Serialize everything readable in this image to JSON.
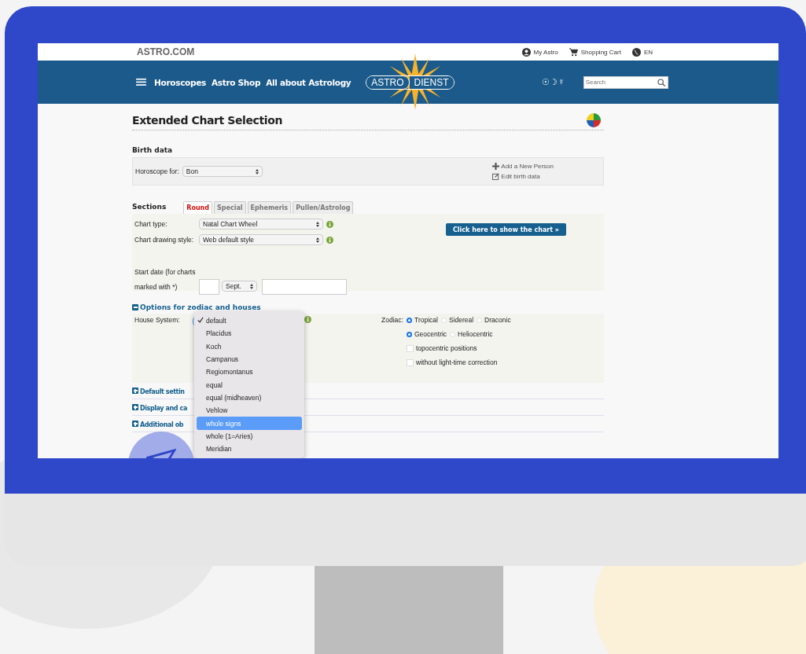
{
  "top_bar": {
    "logo": "ASTRO.COM",
    "links": [
      {
        "kind": "account",
        "label": "My Astro"
      },
      {
        "kind": "cart",
        "label": "Shopping Cart"
      },
      {
        "kind": "language",
        "label": "EN"
      }
    ]
  },
  "nav": {
    "items": [
      "Horoscopes",
      "Astro Shop",
      "All about Astrology"
    ],
    "brand_left": "ASTRO",
    "brand_right": "DIENST",
    "symbols": "☉☽☿",
    "search": {
      "placeholder": "Search"
    }
  },
  "title": "Extended Chart Selection",
  "birth_data": {
    "heading": "Birth data",
    "label": "Horoscope for:",
    "value": "Bon",
    "actions": [
      {
        "kind": "add",
        "label": "Add a New Person"
      },
      {
        "kind": "edit",
        "label": "Edit birth data"
      }
    ]
  },
  "sections": {
    "heading": "Sections",
    "tabs": [
      {
        "label": "Round",
        "selected": true
      },
      {
        "label": "Special",
        "selected": false
      },
      {
        "label": "Ephemeris",
        "selected": false
      },
      {
        "label": "Pullen/Astrolog",
        "selected": false
      }
    ],
    "fields": [
      {
        "label": "Chart type:",
        "value": "Natal Chart Wheel"
      },
      {
        "label": "Chart drawing style:",
        "value": "Web default style"
      }
    ],
    "start_date": {
      "label": "Start date (for charts marked with *)",
      "month": "Sept."
    },
    "button": "Click here to show the chart »"
  },
  "options": {
    "heading": "Options for zodiac and houses",
    "expanded": true,
    "house_label": "House System:",
    "menu": [
      {
        "label": "default",
        "checked": true,
        "selected": false
      },
      {
        "label": "Placidus",
        "checked": false,
        "selected": false
      },
      {
        "label": "Koch",
        "checked": false,
        "selected": false
      },
      {
        "label": "Campanus",
        "checked": false,
        "selected": false
      },
      {
        "label": "Regiomontanus",
        "checked": false,
        "selected": false
      },
      {
        "label": "equal",
        "checked": false,
        "selected": false
      },
      {
        "label": "equal (midheaven)",
        "checked": false,
        "selected": false
      },
      {
        "label": "Vehlow",
        "checked": false,
        "selected": false
      },
      {
        "label": "whole signs",
        "checked": false,
        "selected": true
      },
      {
        "label": "whole (1=Aries)",
        "checked": false,
        "selected": false
      },
      {
        "label": "Meridian",
        "checked": false,
        "selected": false
      }
    ],
    "zodiac_label": "Zodiac:",
    "radio_rows": [
      [
        {
          "label": "Tropical",
          "selected": true
        },
        {
          "label": "Sidereal",
          "selected": false
        },
        {
          "label": "Draconic",
          "selected": false
        }
      ],
      [
        {
          "label": "Geocentric",
          "selected": true
        },
        {
          "label": "Heliocentric",
          "selected": false
        }
      ]
    ],
    "checkboxes": [
      {
        "label": "topocentric positions",
        "checked": false
      },
      {
        "label": "without light-time correction",
        "checked": false
      }
    ]
  },
  "collapsed_sections": [
    {
      "heading": "Default settin",
      "expanded": false
    },
    {
      "heading": "Display and ca",
      "expanded": false
    },
    {
      "heading": "Additional ob",
      "expanded": false
    }
  ]
}
